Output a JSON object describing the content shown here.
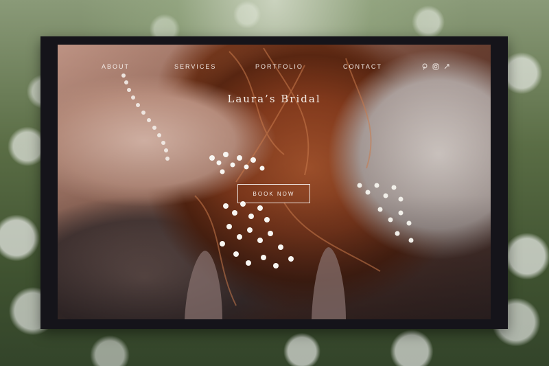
{
  "nav": {
    "about": "ABOUT",
    "services": "SERVICES",
    "portfolio": "PORTFOLIO",
    "contact": "CONTACT"
  },
  "social_icons": [
    "pinterest-icon",
    "instagram-icon",
    "link-icon"
  ],
  "site": {
    "title": "Laura’s Bridal",
    "cta_label": "BOOK NOW"
  },
  "colors": {
    "frame": "#15141a",
    "text": "#f3ece8",
    "hair": "#8e3f1f",
    "meadow": "#4a5a3a"
  }
}
